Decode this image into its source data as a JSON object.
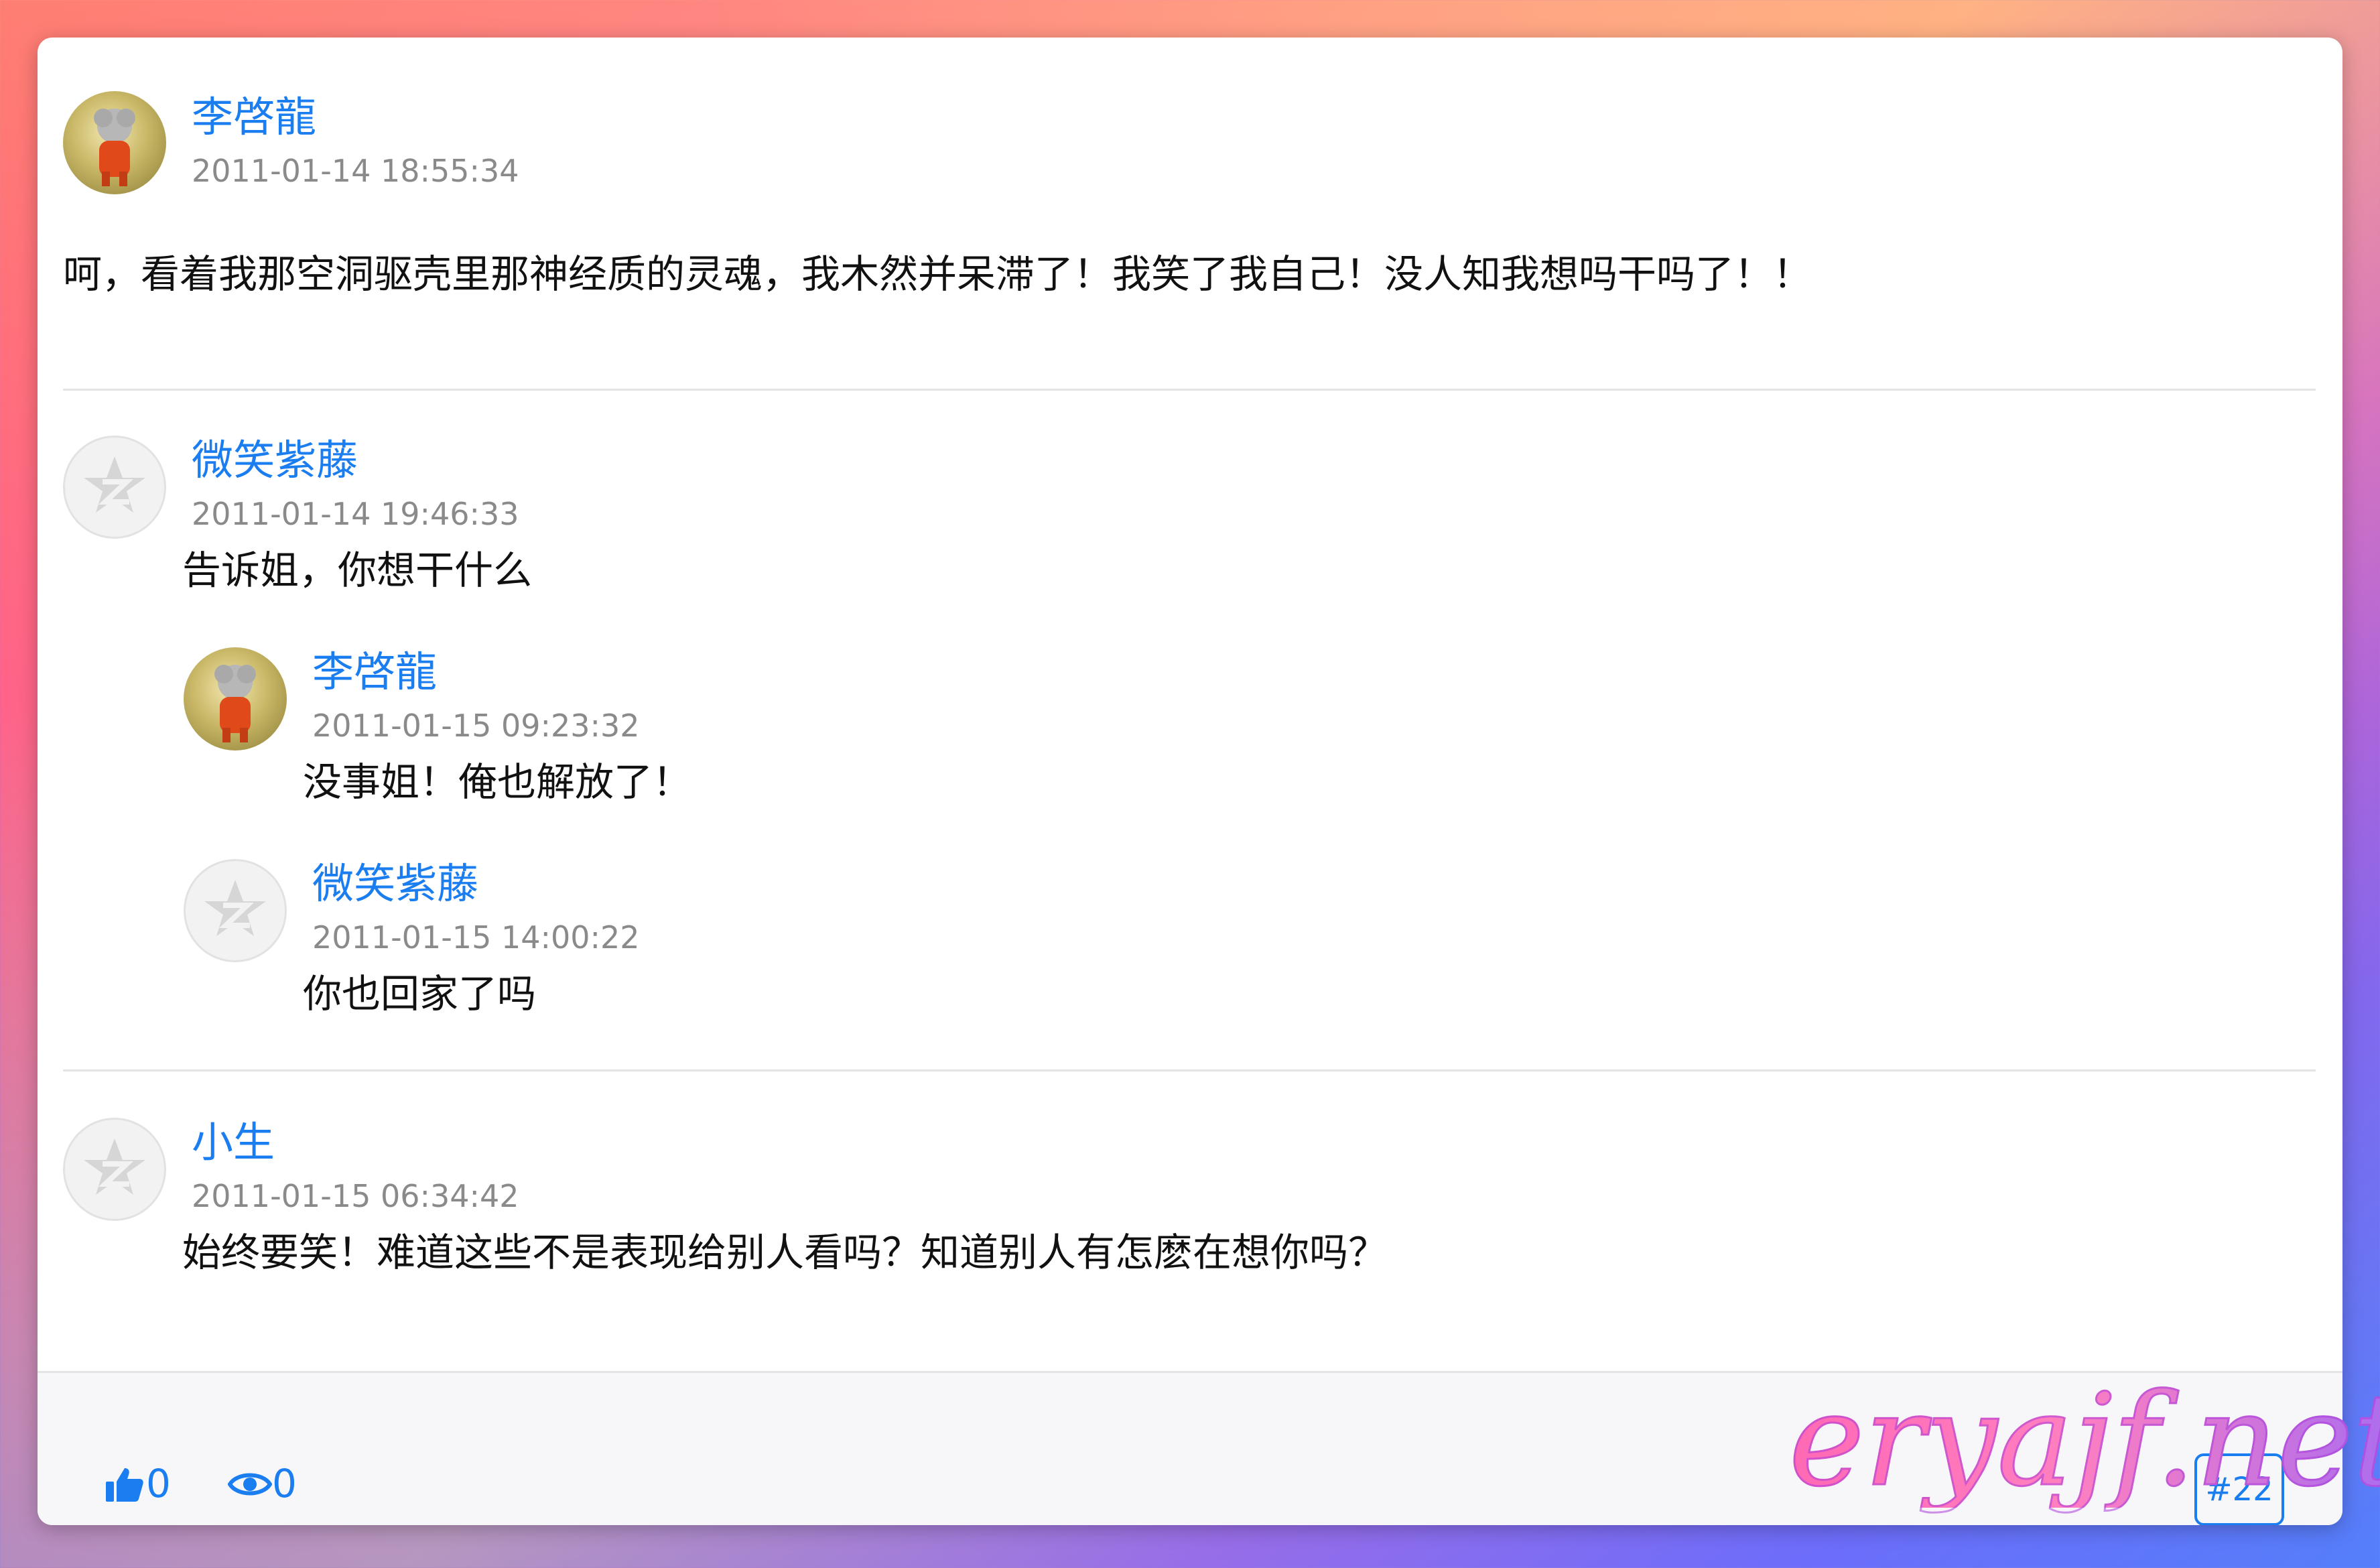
{
  "post": {
    "author": "李啓龍",
    "time": "2011-01-14 18:55:34",
    "content": "呵，看着我那空洞驱壳里那神经质的灵魂，我木然并呆滞了！我笑了我自己！没人知我想吗干吗了！！"
  },
  "comments": [
    {
      "author": "微笑紫藤",
      "time": "2011-01-14 19:46:33",
      "content": "告诉姐，你想干什么",
      "replies": [
        {
          "author": "李啓龍",
          "time": "2011-01-15 09:23:32",
          "content": "没事姐！俺也解放了！"
        },
        {
          "author": "微笑紫藤",
          "time": "2011-01-15 14:00:22",
          "content": "你也回家了吗"
        }
      ]
    },
    {
      "author": "小生",
      "time": "2011-01-15 06:34:42",
      "content": "始终要笑！难道这些不是表现给别人看吗？知道别人有怎麽在想你吗？"
    }
  ],
  "footer": {
    "likes": "0",
    "views": "0",
    "floor": "#22",
    "like_icon": "thumbs-up-icon",
    "view_icon": "eye-icon"
  },
  "watermark": "eryajf.net",
  "colors": {
    "accent": "#1a7df0",
    "text": "#111111",
    "muted": "#8a8a8a"
  }
}
